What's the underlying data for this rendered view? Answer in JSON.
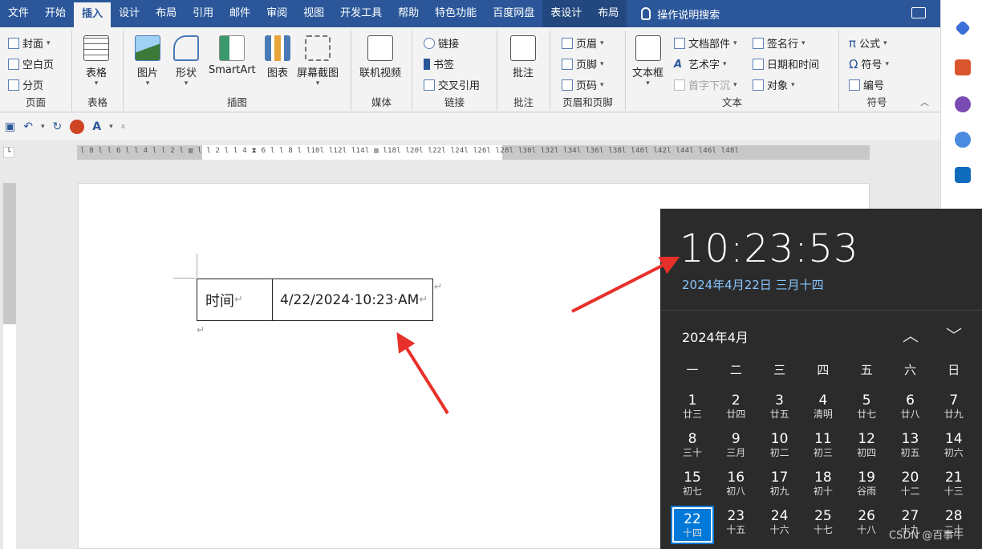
{
  "menu": {
    "items": [
      "文件",
      "开始",
      "插入",
      "设计",
      "布局",
      "引用",
      "邮件",
      "审阅",
      "视图",
      "开发工具",
      "帮助",
      "特色功能",
      "百度网盘",
      "表设计",
      "布局"
    ],
    "search": "操作说明搜索"
  },
  "ribbon": {
    "pages": {
      "label": "页面",
      "cover": "封面",
      "blank": "空白页",
      "break": "分页"
    },
    "tables": {
      "label": "表格",
      "table": "表格"
    },
    "illustrations": {
      "label": "插图",
      "picture": "图片",
      "shapes": "形状",
      "smartart": "SmartArt",
      "chart": "图表",
      "screenshot": "屏幕截图"
    },
    "media": {
      "label": "媒体",
      "video": "联机视频"
    },
    "links": {
      "label": "链接",
      "link": "链接",
      "bookmark": "书签",
      "crossref": "交叉引用"
    },
    "comments": {
      "label": "批注",
      "comment": "批注"
    },
    "header_footer": {
      "label": "页眉和页脚",
      "header": "页眉",
      "footer": "页脚",
      "page_number": "页码"
    },
    "text": {
      "label": "文本",
      "textbox": "文本框",
      "quick_parts": "文档部件",
      "wordart": "艺术字",
      "dropcap": "首字下沉",
      "signature": "签名行",
      "datetime": "日期和时间",
      "object": "对象"
    },
    "symbols": {
      "label": "符号",
      "equation": "公式",
      "symbol": "符号",
      "numbering": "编号"
    }
  },
  "ruler": {
    "ticks": "l 8 l  l 6 l  l 4 l  l 2 l  ▥  l   l 2 l  l 4  ⧗ 6 l  l 8 l  l10l  l12l  l14l  ▥  l18l  l20l  l22l  l24l  l26l  l28l  l30l  l32l  l34l  l36l  l38l  l40l  l42l  l44l  l46l  l48l"
  },
  "document": {
    "cell_label": "时间",
    "cell_value": "4/22/2024·10:23·AM",
    "return_mark": "↵"
  },
  "clock": {
    "time": "10:23:53",
    "date": "2024年4月22日 三月十四",
    "month": "2024年4月",
    "weekdays": [
      "一",
      "二",
      "三",
      "四",
      "五",
      "六",
      "日"
    ],
    "days": [
      {
        "n": "1",
        "l": "廿三"
      },
      {
        "n": "2",
        "l": "廿四"
      },
      {
        "n": "3",
        "l": "廿五"
      },
      {
        "n": "4",
        "l": "清明"
      },
      {
        "n": "5",
        "l": "廿七"
      },
      {
        "n": "6",
        "l": "廿八"
      },
      {
        "n": "7",
        "l": "廿九"
      },
      {
        "n": "8",
        "l": "三十"
      },
      {
        "n": "9",
        "l": "三月"
      },
      {
        "n": "10",
        "l": "初二"
      },
      {
        "n": "11",
        "l": "初三"
      },
      {
        "n": "12",
        "l": "初四"
      },
      {
        "n": "13",
        "l": "初五"
      },
      {
        "n": "14",
        "l": "初六"
      },
      {
        "n": "15",
        "l": "初七"
      },
      {
        "n": "16",
        "l": "初八"
      },
      {
        "n": "17",
        "l": "初九"
      },
      {
        "n": "18",
        "l": "初十"
      },
      {
        "n": "19",
        "l": "谷雨"
      },
      {
        "n": "20",
        "l": "十二"
      },
      {
        "n": "21",
        "l": "十三"
      },
      {
        "n": "22",
        "l": "十四"
      },
      {
        "n": "23",
        "l": "十五"
      },
      {
        "n": "24",
        "l": "十六"
      },
      {
        "n": "25",
        "l": "十七"
      },
      {
        "n": "26",
        "l": "十八"
      },
      {
        "n": "27",
        "l": "十九"
      },
      {
        "n": "28",
        "l": "二十"
      }
    ],
    "today": "22"
  },
  "watermark": "CSDN @百事牛",
  "colors": {
    "ribbon_blue": "#2b579a",
    "today_blue": "#0078d7",
    "arrow_red": "#e8302a",
    "clock_bg": "#2b2b2b"
  }
}
